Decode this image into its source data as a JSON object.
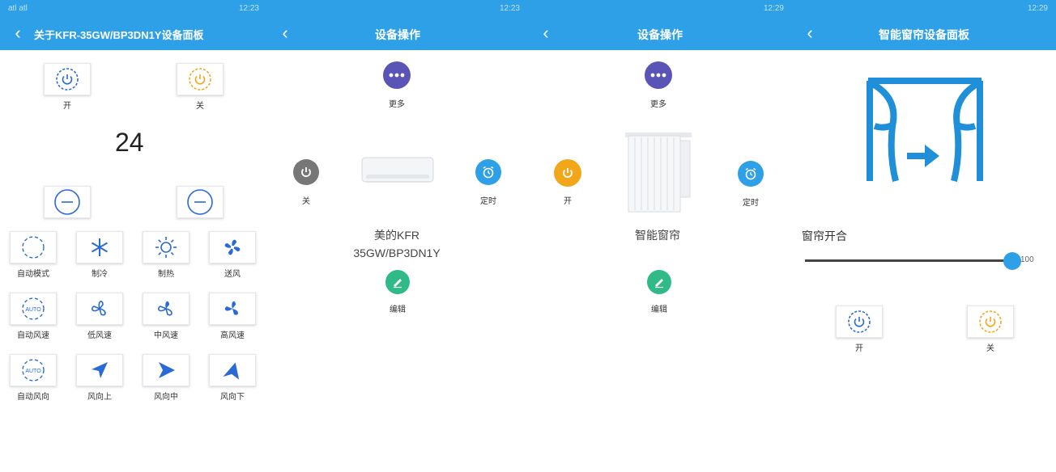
{
  "status": {
    "signal": "atl atl",
    "time1": "12:23",
    "time2": "12:23",
    "time3": "12:29",
    "time4": "12:29"
  },
  "p1": {
    "title": "关于KFR-35GW/BP3DN1Y设备面板",
    "on_label": "开",
    "off_label": "关",
    "temperature": "24",
    "modes": [
      {
        "label": "自动模式",
        "icon": "auto-icon"
      },
      {
        "label": "制冷",
        "icon": "snowflake-icon"
      },
      {
        "label": "制热",
        "icon": "sun-icon"
      },
      {
        "label": "送风",
        "icon": "fan-icon"
      },
      {
        "label": "自动风速",
        "icon": "auto-fan-icon"
      },
      {
        "label": "低风速",
        "icon": "fan-low-icon"
      },
      {
        "label": "中风速",
        "icon": "fan-mid-icon"
      },
      {
        "label": "高风速",
        "icon": "fan-high-icon"
      },
      {
        "label": "自动风向",
        "icon": "auto-direction-icon"
      },
      {
        "label": "风向上",
        "icon": "arrow-up-icon"
      },
      {
        "label": "风向中",
        "icon": "arrow-mid-icon"
      },
      {
        "label": "风向下",
        "icon": "arrow-down-icon"
      }
    ]
  },
  "p2": {
    "title": "设备操作",
    "more_label": "更多",
    "power_label": "关",
    "timer_label": "定时",
    "device_name_line1": "美的KFR",
    "device_name_line2": "35GW/BP3DN1Y",
    "edit_label": "编辑"
  },
  "p3": {
    "title": "设备操作",
    "more_label": "更多",
    "power_label": "开",
    "timer_label": "定时",
    "device_name": "智能窗帘",
    "edit_label": "编辑"
  },
  "p4": {
    "title": "智能窗帘设备面板",
    "slider_label": "窗帘开合",
    "slider_value": "100",
    "slider_level": 100,
    "on_label": "开",
    "off_label": "关"
  },
  "colors": {
    "brand": "#2ea0e8",
    "power_blue": "#2a6ad6",
    "power_orange": "#f2a71b",
    "more_purple": "#5a54b6",
    "edit_green": "#2fba88"
  }
}
